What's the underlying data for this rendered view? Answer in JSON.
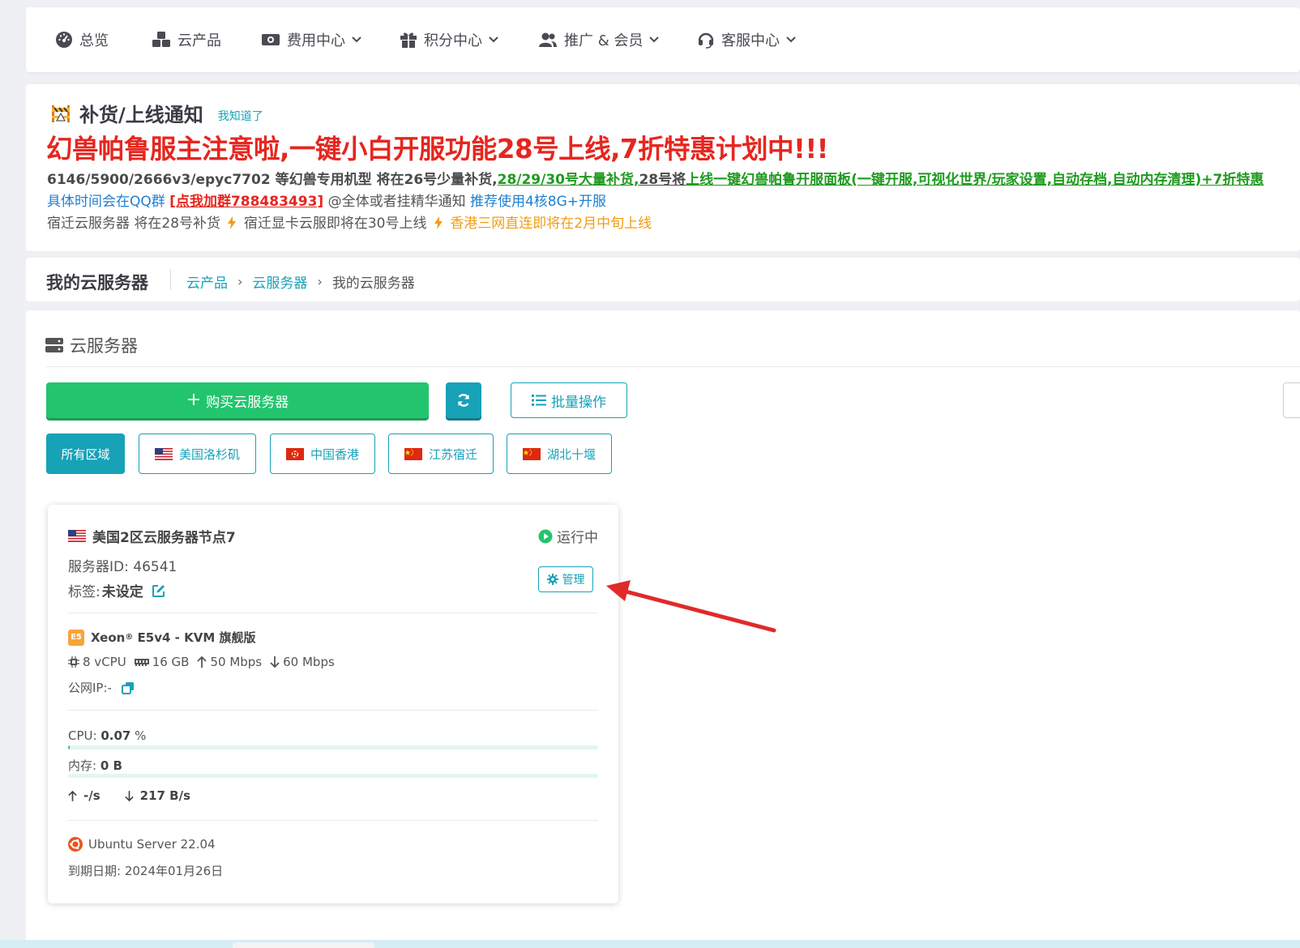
{
  "nav": {
    "items": [
      {
        "label": "总览",
        "icon": "dashboard-icon",
        "dropdown": false
      },
      {
        "label": "云产品",
        "icon": "cubes-icon",
        "dropdown": false
      },
      {
        "label": "费用中心",
        "icon": "money-icon",
        "dropdown": true
      },
      {
        "label": "积分中心",
        "icon": "gift-icon",
        "dropdown": true
      },
      {
        "label": "推广 & 会员",
        "icon": "users-icon",
        "dropdown": true
      },
      {
        "label": "客服中心",
        "icon": "headset-icon",
        "dropdown": true
      }
    ]
  },
  "notice": {
    "icon": "construction-icon",
    "title": "补货/上线通知",
    "ack": "我知道了",
    "headline": "幻兽帕鲁服主注意啦,一键小白开服功能28号上线,7折特惠计划中!!!",
    "line1_a": "6146/5900/2666v3/epyc7702 等幻兽专用机型 将在26号少量补货,",
    "line1_b": "28/29/30号大量补货,",
    "line1_c": "28号将",
    "line1_d": "上线一键幻兽帕鲁开服面板(一键开服,可视化世界/玩家设置,自动存档,自动内存清理)+7折特惠",
    "line2_a": "具体时间会在QQ群",
    "line2_b": "[点我加群788483493]",
    "line2_c": "@全体或者挂精华通知",
    "line2_d": "推荐使用4核8G+开服",
    "line3_a": "宿迁云服务器 将在28号补货",
    "line3_b": "宿迁显卡云服即将在30号上线",
    "line3_c": "香港三网直连即将在2月中旬上线"
  },
  "breadcrumb": {
    "page_title": "我的云服务器",
    "items": [
      "云产品",
      "云服务器",
      "我的云服务器"
    ]
  },
  "section": {
    "title": "云服务器",
    "buy_label": "购买云服务器",
    "batch_label": "批量操作"
  },
  "regions": [
    {
      "label": "所有区域",
      "flag": "",
      "active": true
    },
    {
      "label": "美国洛杉矶",
      "flag": "us-flag-icon",
      "active": false
    },
    {
      "label": "中国香港",
      "flag": "hk-flag-icon",
      "active": false
    },
    {
      "label": "江苏宿迁",
      "flag": "cn-flag-icon",
      "active": false
    },
    {
      "label": "湖北十堰",
      "flag": "cn-flag-icon",
      "active": false
    }
  ],
  "server": {
    "name": "美国2区云服务器节点7",
    "status": "运行中",
    "id_label": "服务器ID: ",
    "id_value": "46541",
    "tag_label": "标签: ",
    "tag_value": "未设定",
    "manage_label": "管理",
    "cpu_badge": "E5",
    "cpu_model_a": "Xeon",
    "cpu_model_sup": "®",
    "cpu_model_b": " E5v4 - KVM 旗舰版",
    "vcpu": "8 vCPU",
    "ram": "16 GB",
    "bw_up": "50 Mbps",
    "bw_down": "60 Mbps",
    "ip_label": "公网IP: ",
    "ip_value": "-",
    "cpu_label": "CPU: ",
    "cpu_value": "0.07",
    "cpu_unit": " %",
    "cpu_usage": 0.0007,
    "mem_label": "内存: ",
    "mem_value": "0 B",
    "mem_usage": 0,
    "net_up": "-/s",
    "net_down": "217 B/s",
    "os": "Ubuntu Server 22.04",
    "expire_label": "到期日期: ",
    "expire_value": "2024年01月26日"
  },
  "colors": {
    "accent": "#17a2b8",
    "success": "#22c56d",
    "danger": "#e6261f",
    "warning": "#f39c12",
    "annotation_arrow": "#e02a2a"
  }
}
